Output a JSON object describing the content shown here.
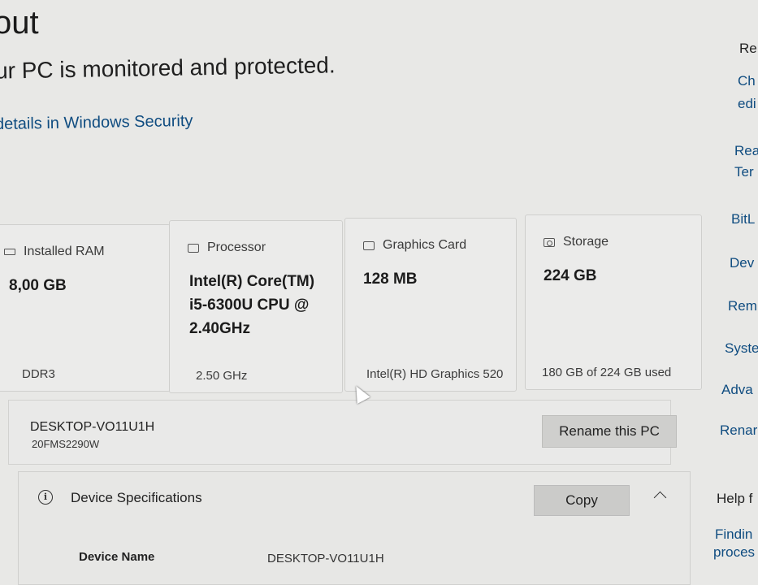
{
  "header": {
    "title": "out",
    "security_status": "ur PC is monitored and protected.",
    "security_link": "details in Windows Security"
  },
  "specs": {
    "ram": {
      "label": "Installed RAM",
      "value": "8,00 GB",
      "footer": "DDR3",
      "icon": "memory-icon"
    },
    "processor": {
      "label": "Processor",
      "value": "Intel(R) Core(TM) i5-6300U CPU @ 2.40GHz",
      "footer": "2.50 GHz",
      "icon": "processor-icon"
    },
    "graphics": {
      "label": "Graphics Card",
      "value": "128 MB",
      "footer": "Intel(R) HD Graphics 520",
      "icon": "graphics-card-icon"
    },
    "storage": {
      "label": "Storage",
      "value": "224 GB",
      "footer": "180 GB of 224 GB used",
      "icon": "storage-icon"
    }
  },
  "device": {
    "name": "DESKTOP-VO11U1H",
    "model": "20FMS2290W",
    "rename_label": "Rename this PC"
  },
  "device_specs": {
    "title": "Device Specifications",
    "copy_label": "Copy",
    "rows": [
      {
        "label": "Device Name",
        "value": "DESKTOP-VO11U1H"
      }
    ]
  },
  "right_panel": {
    "items": [
      "Re",
      "Ch",
      "edi",
      "Rea",
      "Ter",
      "BitL",
      "Dev",
      "Rem",
      "Syste",
      "Adva",
      "Renar",
      "Help f",
      "Findin",
      "proces"
    ]
  }
}
